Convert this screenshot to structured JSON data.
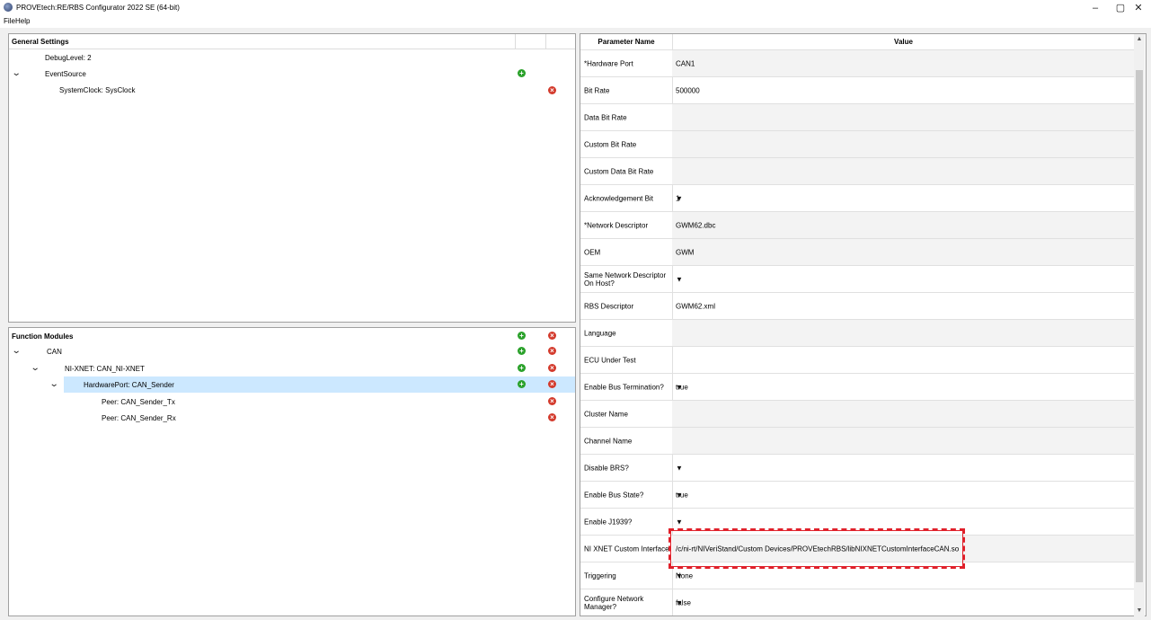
{
  "window": {
    "title": "PROVEtech:RE/RBS Configurator 2022 SE (64-bit)",
    "controls": {
      "minimize": "–",
      "maximize": "▢",
      "close": "✕"
    }
  },
  "menu": {
    "items": [
      "File",
      "Help"
    ]
  },
  "general_settings": {
    "title": "General Settings",
    "rows": [
      {
        "label": "DebugLevel: 2"
      },
      {
        "label": "EventSource",
        "expander": "⌄",
        "add": "+"
      },
      {
        "label": "SystemClock: SysClock",
        "remove": "×"
      }
    ]
  },
  "function_modules": {
    "title": "Function Modules",
    "header_add": "+",
    "header_remove": "×",
    "rows": [
      {
        "label": "CAN",
        "expander": "⌄",
        "add": "+",
        "remove": "×"
      },
      {
        "label": "NI-XNET: CAN_NI-XNET",
        "expander": "⌄",
        "add": "+",
        "remove": "×"
      },
      {
        "label": "HardwarePort: CAN_Sender",
        "expander": "⌄",
        "add": "+",
        "remove": "×",
        "selected": true
      },
      {
        "label": "Peer: CAN_Sender_Tx",
        "remove": "×"
      },
      {
        "label": "Peer: CAN_Sender_Rx",
        "remove": "×"
      }
    ]
  },
  "parameters": {
    "col_name": "Parameter Name",
    "col_value": "Value",
    "dropdown_glyph": "▼",
    "rows": [
      {
        "name": "*Hardware Port",
        "value": "CAN1",
        "dropdown": false
      },
      {
        "name": "Bit Rate",
        "value": "500000",
        "dropdown": false
      },
      {
        "name": "Data Bit Rate",
        "value": "",
        "dropdown": false
      },
      {
        "name": "Custom Bit Rate",
        "value": "",
        "dropdown": false
      },
      {
        "name": "Custom Data Bit Rate",
        "value": "",
        "dropdown": false
      },
      {
        "name": "Acknowledgement Bit",
        "value": "1",
        "dropdown": true
      },
      {
        "name": "*Network Descriptor",
        "value": "GWM62.dbc",
        "dropdown": false
      },
      {
        "name": "OEM",
        "value": "GWM",
        "dropdown": false
      },
      {
        "name": "Same Network Descriptor On Host?",
        "value": "",
        "dropdown": true
      },
      {
        "name": "RBS Descriptor",
        "value": "GWM62.xml",
        "dropdown": false
      },
      {
        "name": "Language",
        "value": "",
        "dropdown": false
      },
      {
        "name": "ECU Under Test",
        "value": "",
        "dropdown": false
      },
      {
        "name": "Enable Bus Termination?",
        "value": "true",
        "dropdown": true
      },
      {
        "name": "Cluster Name",
        "value": "",
        "dropdown": false
      },
      {
        "name": "Channel Name",
        "value": "",
        "dropdown": false
      },
      {
        "name": "Disable BRS?",
        "value": "",
        "dropdown": true
      },
      {
        "name": "Enable Bus State?",
        "value": "true",
        "dropdown": true
      },
      {
        "name": "Enable J1939?",
        "value": "",
        "dropdown": true
      },
      {
        "name": "NI XNET Custom Interface",
        "value": "/c/ni-rt/NIVeriStand/Custom Devices/PROVEtechRBS/libNIXNETCustomInterfaceCAN.so",
        "dropdown": false
      },
      {
        "name": "Triggering",
        "value": "None",
        "dropdown": true
      },
      {
        "name": "Configure Network Manager?",
        "value": "false",
        "dropdown": true
      }
    ]
  },
  "scrollbar": {
    "up": "▲",
    "down": "▼"
  },
  "colors": {
    "selection": "#cce8ff",
    "add": "#2aa12a",
    "remove": "#d33a2c",
    "highlight": "#e0202a"
  }
}
